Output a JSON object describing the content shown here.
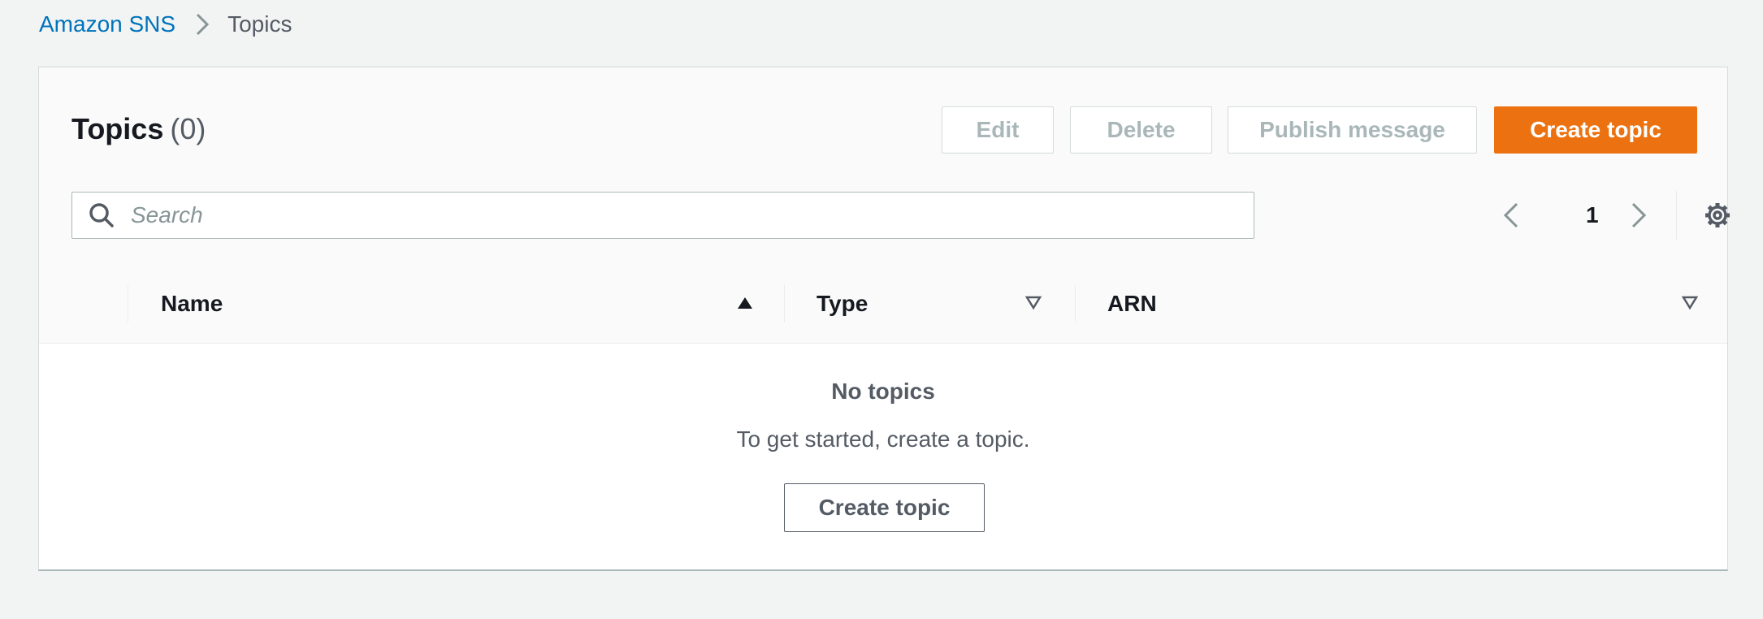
{
  "breadcrumb": {
    "items": [
      {
        "label": "Amazon SNS"
      },
      {
        "label": "Topics"
      }
    ]
  },
  "header": {
    "title": "Topics",
    "count": "(0)",
    "actions": {
      "edit": "Edit",
      "delete": "Delete",
      "publish": "Publish message",
      "create": "Create topic"
    }
  },
  "search": {
    "placeholder": "Search",
    "value": ""
  },
  "pagination": {
    "current_page": "1"
  },
  "table": {
    "columns": [
      {
        "label": "Name",
        "sort": "ascending"
      },
      {
        "label": "Type",
        "sort": "none"
      },
      {
        "label": "ARN",
        "sort": "none"
      }
    ],
    "rows": []
  },
  "empty_state": {
    "title": "No topics",
    "description": "To get started, create a topic.",
    "button": "Create topic"
  },
  "colors": {
    "accent": "#ec7211",
    "link": "#0073bb",
    "page_bg": "#f2f3f3"
  },
  "icons": [
    "chevron-right-icon",
    "search-icon",
    "chevron-left-icon",
    "chevron-right-icon",
    "gear-icon",
    "sort-ascending-icon",
    "sort-descending-icon"
  ]
}
